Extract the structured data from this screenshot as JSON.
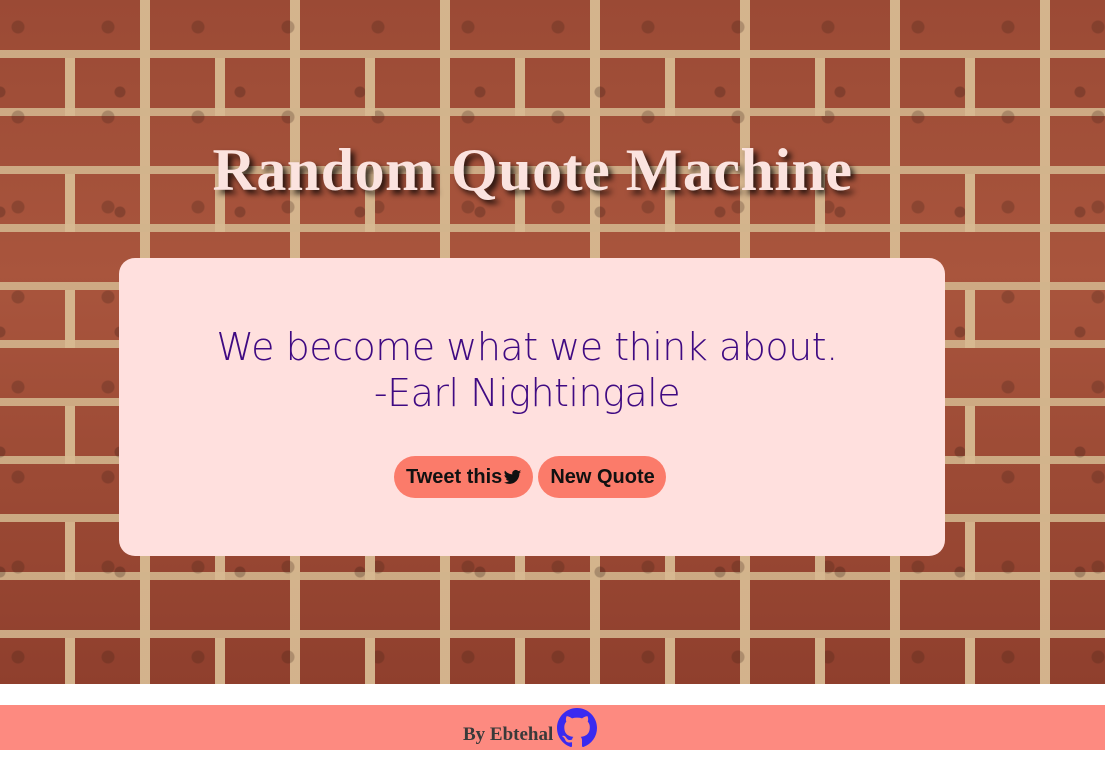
{
  "header": {
    "title": "Random Quote Machine"
  },
  "quote": {
    "text": "We become what we think about.",
    "author": "-Earl Nightingale"
  },
  "actions": {
    "tweet_label": "Tweet this",
    "tweet_icon": "twitter-icon",
    "new_quote_label": "New Quote"
  },
  "footer": {
    "credit": "By Ebtehal",
    "icon": "github-icon"
  },
  "colors": {
    "card_bg": "#ffe0de",
    "quote_text": "#3f0a82",
    "button_bg": "#fb7b6a",
    "footer_bg": "#fd8a80",
    "github_icon": "#3a2af0"
  }
}
